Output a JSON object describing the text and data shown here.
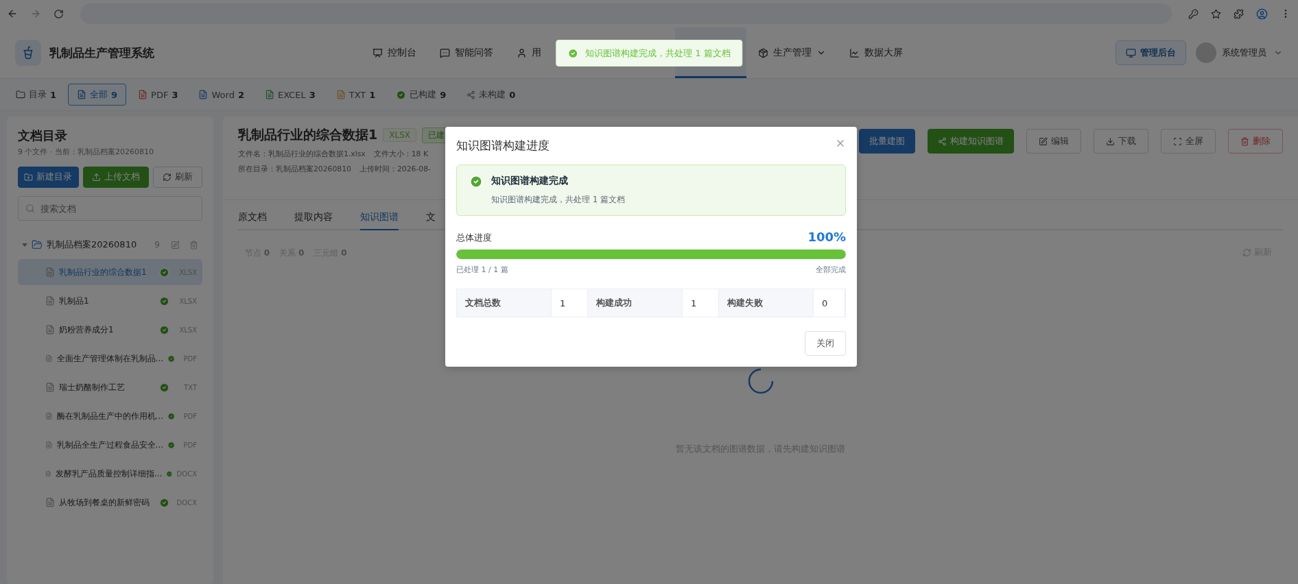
{
  "header": {
    "app_title": "乳制品生产管理系统",
    "nav": [
      {
        "kind": "console",
        "label": "控制台",
        "selected": false,
        "dropdown": false
      },
      {
        "kind": "chat",
        "label": "智能问答",
        "selected": false,
        "dropdown": false
      },
      {
        "kind": "user",
        "label": "用",
        "selected": false,
        "dropdown": false
      },
      {
        "kind": "blank",
        "selected": true,
        "dropdown": false
      },
      {
        "kind": "package",
        "label": "生产管理",
        "selected": false,
        "dropdown": true
      },
      {
        "kind": "chart",
        "label": "数据大屏",
        "selected": false,
        "dropdown": false
      }
    ],
    "admin_button": "管理后台",
    "user_name": "系统管理员"
  },
  "toast": {
    "message": "知识图谱构建完成，共处理 1 篇文档"
  },
  "filters": [
    {
      "kind": "folder",
      "label": "目录",
      "count": "1",
      "selected": false
    },
    {
      "kind": "all",
      "label": "全部",
      "count": "9",
      "selected": true
    },
    {
      "kind": "pdf",
      "label": "PDF",
      "count": "3",
      "selected": false
    },
    {
      "kind": "word",
      "label": "Word",
      "count": "2",
      "selected": false
    },
    {
      "kind": "excel",
      "label": "EXCEL",
      "count": "3",
      "selected": false
    },
    {
      "kind": "txt",
      "label": "TXT",
      "count": "1",
      "selected": false
    },
    {
      "kind": "built",
      "label": "已构建",
      "count": "9",
      "selected": false
    },
    {
      "kind": "unbuilt",
      "label": "未构建",
      "count": "0",
      "selected": false
    }
  ],
  "sidebar": {
    "title": "文档目录",
    "subtitle": "9 个文件 · 当前：乳制品档案20260810",
    "buttons": [
      {
        "kind": "primary",
        "label": "新建目录"
      },
      {
        "kind": "success",
        "label": "上传文档"
      },
      {
        "kind": "plain",
        "label": "刷新"
      }
    ],
    "search": {
      "placeholder": "搜索文档"
    },
    "tree": [
      {
        "name": "乳制品档案20260810",
        "count": "9",
        "expanded": true,
        "children": [
          {
            "name": "乳制品行业的综合数据1",
            "built": true,
            "type": "XLSX",
            "selected": true
          },
          {
            "name": "乳制品1",
            "built": true,
            "type": "XLSX",
            "selected": false
          },
          {
            "name": "奶粉营养成分1",
            "built": true,
            "type": "XLSX",
            "selected": false
          },
          {
            "name": "全面生产管理体制在乳制品...",
            "built": true,
            "type": "PDF",
            "selected": false
          },
          {
            "name": "瑞士奶酪制作工艺",
            "built": true,
            "type": "TXT",
            "selected": false
          },
          {
            "name": "酶在乳制品生产中的作用机...",
            "built": true,
            "type": "PDF",
            "selected": false
          },
          {
            "name": "乳制品全生产过程食品安全...",
            "built": true,
            "type": "PDF",
            "selected": false
          },
          {
            "name": "发酵乳产品质量控制详细指...",
            "built": true,
            "type": "DOCX",
            "selected": false
          },
          {
            "name": "从牧场到餐桌的新鲜密码",
            "built": true,
            "type": "DOCX",
            "selected": false
          }
        ]
      }
    ]
  },
  "document": {
    "title": "乳制品行业的综合数据1",
    "tags": [
      {
        "kind": "type",
        "label": "XLSX"
      },
      {
        "kind": "status",
        "label": "已建"
      }
    ],
    "meta": [
      [
        "文件名：乳制品行业的综合数据1.xlsx",
        "文件大小：18 K"
      ],
      [
        "所在目录：乳制品档案20260810",
        "上传时间：2026-08-"
      ]
    ],
    "actions": [
      {
        "kind": "primary",
        "label": "批量建图"
      },
      {
        "kind": "success",
        "label": "构建知识图谱"
      },
      {
        "kind": "edit",
        "label": "编辑"
      },
      {
        "kind": "download",
        "label": "下载"
      },
      {
        "kind": "fullscreen",
        "label": "全屏"
      },
      {
        "kind": "delete",
        "label": "删除"
      }
    ],
    "tabs": [
      {
        "label": "原文档",
        "selected": false
      },
      {
        "label": "提取内容",
        "selected": false
      },
      {
        "label": "知识图谱",
        "selected": true
      },
      {
        "label": "文",
        "selected": false
      }
    ],
    "graph": {
      "stats": [
        {
          "label": "节点",
          "value": "0"
        },
        {
          "label": "关系",
          "value": "0"
        },
        {
          "label": "三元组",
          "value": "0"
        }
      ],
      "refresh": "刷新",
      "empty": "暂无该文档的图谱数据，请先构建知识图谱"
    }
  },
  "modal": {
    "title": "知识图谱构建进度",
    "alert": {
      "title": "知识图谱构建完成",
      "message": "知识图谱构建完成，共处理 1 篇文档"
    },
    "progress": {
      "label": "总体进度",
      "percent": "100%",
      "level": 1,
      "processed": "已处理 1 / 1 篇",
      "status": "全部完成"
    },
    "stats": [
      {
        "label": "文档总数",
        "value": "1"
      },
      {
        "label": "构建成功",
        "value": "1"
      },
      {
        "label": "构建失败",
        "value": "0"
      }
    ],
    "close_button": "关闭"
  }
}
